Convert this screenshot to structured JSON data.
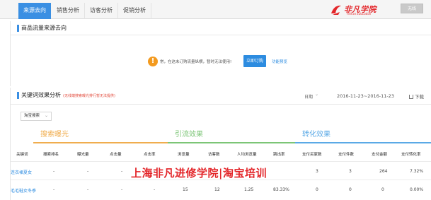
{
  "tabs": [
    {
      "label": "来源去向",
      "active": true
    },
    {
      "label": "销售分析",
      "active": false
    },
    {
      "label": "访客分析",
      "active": false
    },
    {
      "label": "促销分析",
      "active": false
    }
  ],
  "brand": {
    "name": "非凡学院",
    "sub": "FeiFan Education",
    "color": "#e3262a"
  },
  "exit_label": "无线",
  "section1": {
    "title": "商品流量来源去向",
    "notice": "常，在这未订购流量纵横，暂时无法使用!",
    "order_button": "立即订购",
    "intro_link": "功能预览"
  },
  "section2": {
    "title": "关键词效果分析",
    "note": "(无线端搜索曝光排行暂无法提供)",
    "date_label": "日期",
    "date_range": "2016-11-23~2016-11-23",
    "download": "下载",
    "source_select": "淘宝搜索",
    "groups": {
      "search": {
        "title": "搜索曝光",
        "color": "#f0ad4e"
      },
      "traffic": {
        "title": "引流效果",
        "color": "#7cc576"
      },
      "conversion": {
        "title": "转化效果",
        "color": "#5aa9e6"
      }
    },
    "columns": [
      "关键词",
      "搜索排名",
      "曝光量",
      "点击量",
      "点击率",
      "浏览量",
      "访客数",
      "人均浏览量",
      "跳出率",
      "支付买家数",
      "支付件数",
      "支付金额",
      "支付转化率"
    ],
    "rows": [
      {
        "keyword": "连衣裙夏女",
        "cells": [
          "-",
          "-",
          "-",
          "-",
          "",
          "",
          "",
          "",
          "3",
          "3",
          "264",
          "7.32%"
        ]
      },
      {
        "keyword": "毛毛鞋女冬季",
        "cells": [
          "-",
          "-",
          "-",
          "-",
          "15",
          "12",
          "1.25",
          "83.33%",
          "0",
          "0",
          "0",
          "0.00%"
        ]
      }
    ]
  },
  "watermark": "上海非凡进修学院|淘宝培训"
}
